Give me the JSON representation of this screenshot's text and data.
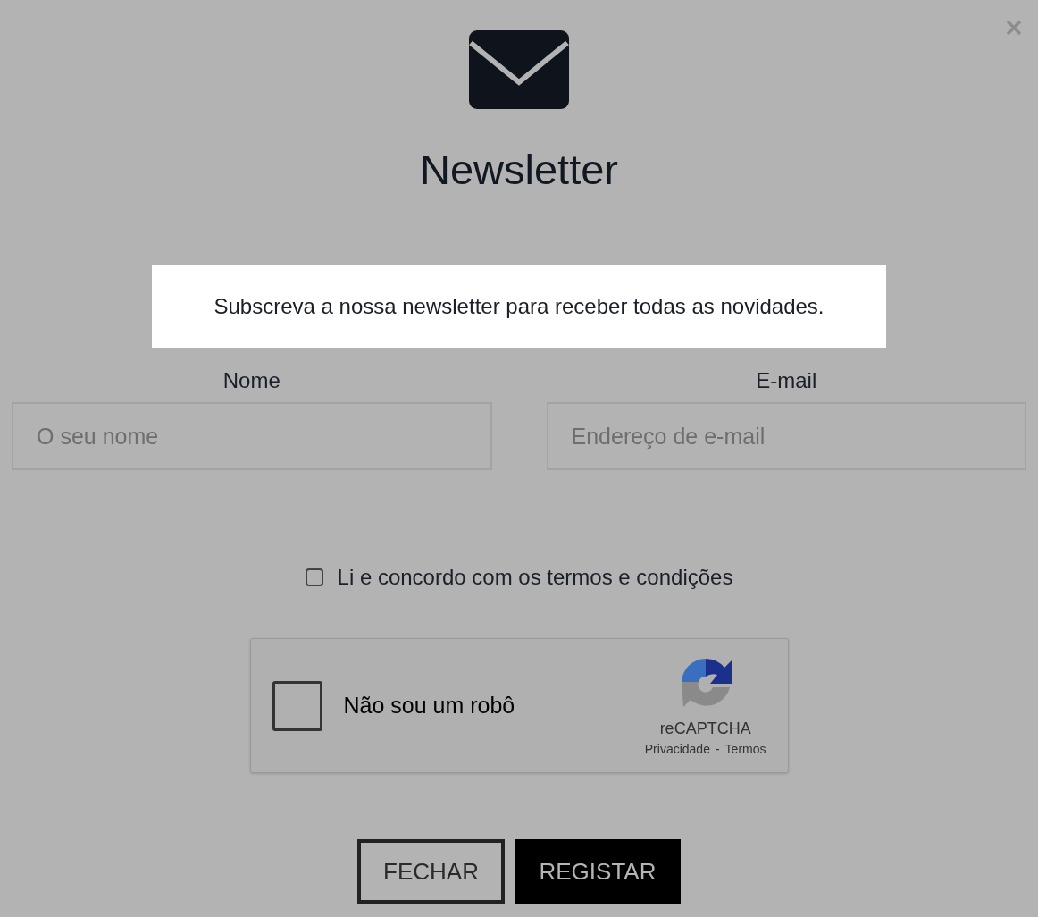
{
  "title": "Newsletter",
  "intro": "Subscreva a nossa newsletter para receber todas as novidades.",
  "fields": [
    {
      "label": "Nome",
      "placeholder": "O seu nome"
    },
    {
      "label": "E-mail",
      "placeholder": "Endereço de e-mail"
    }
  ],
  "terms": {
    "label": "Li e concordo com os termos e condições",
    "checked": false
  },
  "captcha": {
    "label": "Não sou um robô",
    "checked": false,
    "brand": "reCAPTCHA",
    "privacy": "Privacidade",
    "separator": "-",
    "terms": "Termos"
  },
  "buttons": [
    {
      "label": "FECHAR",
      "kind": "outline"
    },
    {
      "label": "REGISTAR",
      "kind": "solid"
    }
  ]
}
